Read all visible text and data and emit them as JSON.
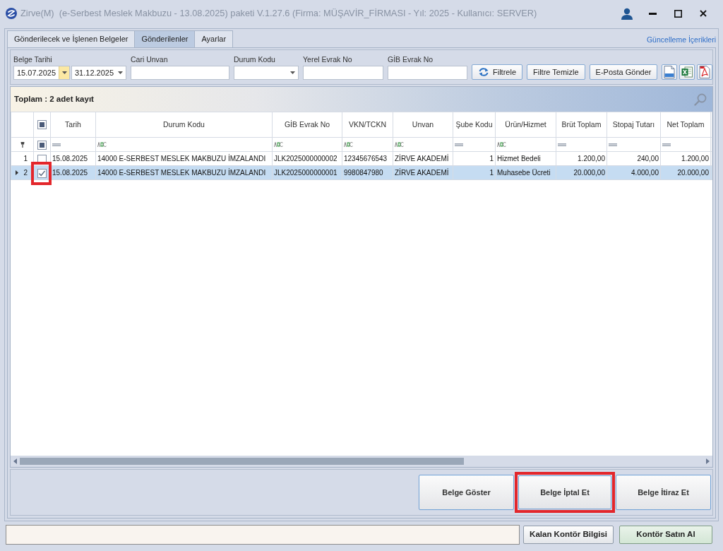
{
  "window": {
    "title": "Zirve(M)  (e-Serbest Meslek Makbuzu - 13.08.2025) paketi V.1.27.6 (Firma: MÜŞAVİR_FİRMASI - Yıl: 2025 - Kullanıcı: SERVER)"
  },
  "tabs": [
    {
      "label": "Gönderilecek ve İşlenen Belgeler",
      "selected": false
    },
    {
      "label": "Gönderilenler",
      "selected": true
    },
    {
      "label": "Ayarlar",
      "selected": false
    }
  ],
  "update_link": "Güncelleme İçerikleri",
  "filters": {
    "date": {
      "label": "Belge Tarihi",
      "pickers": [
        {
          "value": "15.07.2025",
          "focused": true
        },
        {
          "value": "31.12.2025",
          "focused": false
        }
      ]
    },
    "fields": [
      {
        "label": "Cari Unvan",
        "kind": "text"
      },
      {
        "label": "Durum Kodu",
        "kind": "dropdown"
      },
      {
        "label": "Yerel Evrak No",
        "kind": "text"
      },
      {
        "label": "GİB Evrak No",
        "kind": "text"
      }
    ],
    "buttons": [
      {
        "label": "Filtrele",
        "kind": "refresh"
      },
      {
        "label": "Filtre Temizle",
        "kind": "plain"
      },
      {
        "label": "E-Posta Gönder",
        "kind": "plain"
      }
    ],
    "exports": [
      {
        "kind": "xml"
      },
      {
        "kind": "excel"
      },
      {
        "kind": "pdf"
      }
    ]
  },
  "grid": {
    "summary": "Toplam : 2 adet kayıt",
    "header_checkbox": {
      "indeterminate": true
    },
    "filter_checkbox": {
      "indeterminate": true
    },
    "columns": [
      {
        "label": "Tarih",
        "kind": "date"
      },
      {
        "label": "Durum Kodu",
        "kind": "text"
      },
      {
        "label": "GİB Evrak No",
        "kind": "text"
      },
      {
        "label": "VKN/TCKN",
        "kind": "text"
      },
      {
        "label": "Unvan",
        "kind": "text"
      },
      {
        "label": "Şube Kodu",
        "kind": "number"
      },
      {
        "label": "Ürün/Hizmet",
        "kind": "text"
      },
      {
        "label": "Brüt Toplam",
        "kind": "number"
      },
      {
        "label": "Stopaj Tutarı",
        "kind": "number"
      },
      {
        "label": "Net Toplam",
        "kind": "number"
      }
    ],
    "rows": [
      {
        "number": "1",
        "selected": false,
        "checked": false,
        "highlighted": false,
        "cells": [
          "15.08.2025",
          "14000 E-SERBEST MESLEK MAKBUZU İMZALANDI",
          "JLK2025000000002",
          "12345676543",
          "ZİRVE AKADEMİ",
          "1",
          "Hizmet Bedeli",
          "1.200,00",
          "240,00",
          "1.200,00"
        ]
      },
      {
        "number": "2",
        "selected": true,
        "checked": true,
        "highlighted": true,
        "cells": [
          "15.08.2025",
          "14000 E-SERBEST MESLEK MAKBUZU İMZALANDI",
          "JLK2025000000001",
          "9980847980",
          "ZİRVE AKADEMİ",
          "1",
          "Muhasebe Ücreti",
          "20.000,00",
          "4.000,00",
          "20.000,00"
        ]
      }
    ]
  },
  "bottom_buttons": [
    {
      "label": "Belge Göster",
      "highlighted": false
    },
    {
      "label": "Belge İptal Et",
      "highlighted": true
    },
    {
      "label": "Belge İtiraz Et",
      "highlighted": false
    }
  ],
  "status_bar": {
    "buttons": [
      {
        "label": "Kalan Kontör Bilgisi",
        "kind": "plain"
      },
      {
        "label": "Kontör Satın Al",
        "kind": "green"
      }
    ]
  }
}
